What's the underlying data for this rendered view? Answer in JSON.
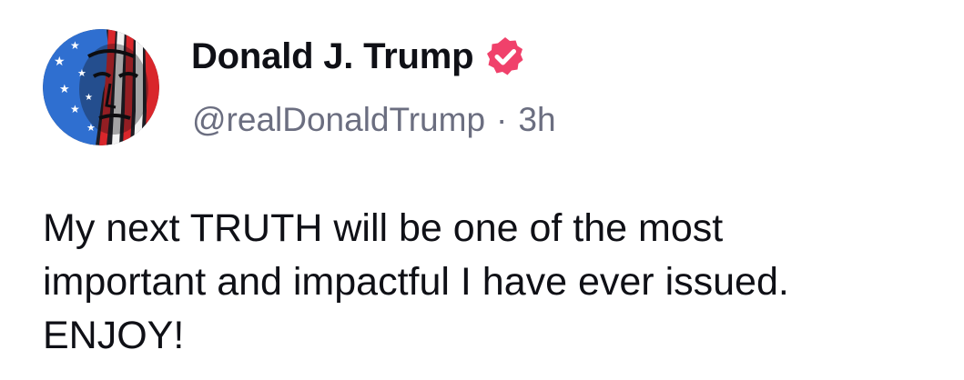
{
  "post": {
    "author": {
      "display_name": "Donald J. Trump",
      "handle": "@realDonaldTrump",
      "verified": true,
      "avatar_icon": "flag-portrait-avatar",
      "verified_badge_color": "#f0416b"
    },
    "separator": "·",
    "timestamp": "3h",
    "text": "My next TRUTH will be one of the most\nimportant and impactful I have ever issued.\nENJOY!"
  },
  "colors": {
    "text_primary": "#0f1016",
    "text_secondary": "#6b6e80",
    "background": "#ffffff",
    "verified": "#f0416b"
  }
}
